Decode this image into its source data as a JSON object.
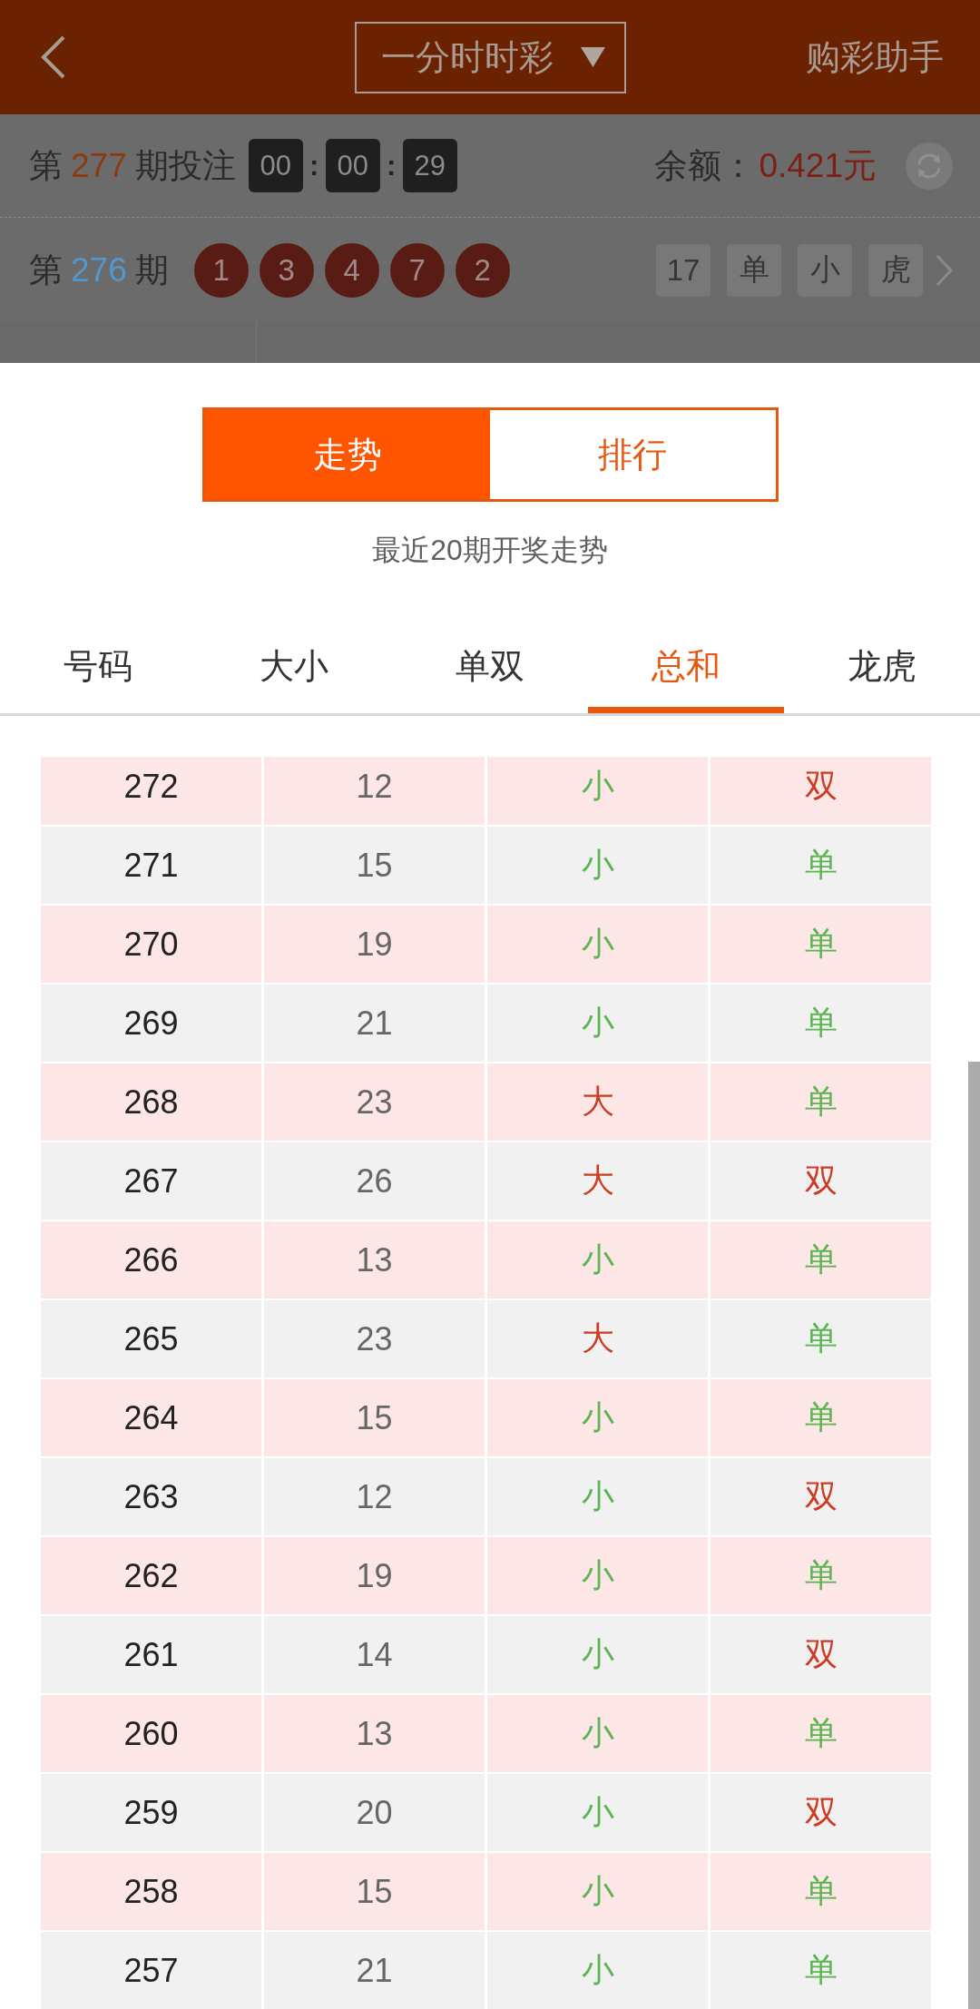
{
  "header": {
    "title": "一分时时彩",
    "assistant": "购彩助手"
  },
  "current_issue": {
    "prefix": "第",
    "number": "277",
    "suffix": "期投注",
    "countdown": [
      {
        "kind": "digits",
        "text": "00"
      },
      {
        "kind": "separator",
        "text": ":"
      },
      {
        "kind": "digits",
        "text": "00"
      },
      {
        "kind": "separator",
        "text": ":"
      },
      {
        "kind": "digits",
        "text": "29"
      }
    ],
    "balance_label": "余额：",
    "balance": "0.421元"
  },
  "last_draw": {
    "prefix": "第",
    "number": "276",
    "suffix": "期",
    "balls": [
      "1",
      "3",
      "4",
      "7",
      "2"
    ],
    "tags": [
      "17",
      "单",
      "小",
      "虎"
    ]
  },
  "view_switch": [
    {
      "label": "走势",
      "selected": true
    },
    {
      "label": "排行",
      "selected": false
    }
  ],
  "subtitle": "最近20期开奖走势",
  "tabs": [
    {
      "label": "号码",
      "selected": false
    },
    {
      "label": "大小",
      "selected": false
    },
    {
      "label": "单双",
      "selected": false
    },
    {
      "label": "总和",
      "selected": true
    },
    {
      "label": "龙虎",
      "selected": false
    }
  ],
  "table": {
    "rows": [
      {
        "column_1": "272",
        "column_2": "12",
        "column_3": {
          "text": "小",
          "color": "#5cb552"
        },
        "column_4": {
          "text": "双",
          "color": "#cc3b22"
        }
      },
      {
        "column_1": "271",
        "column_2": "15",
        "column_3": {
          "text": "小",
          "color": "#5cb552"
        },
        "column_4": {
          "text": "单",
          "color": "#5cb552"
        }
      },
      {
        "column_1": "270",
        "column_2": "19",
        "column_3": {
          "text": "小",
          "color": "#5cb552"
        },
        "column_4": {
          "text": "单",
          "color": "#5cb552"
        }
      },
      {
        "column_1": "269",
        "column_2": "21",
        "column_3": {
          "text": "小",
          "color": "#5cb552"
        },
        "column_4": {
          "text": "单",
          "color": "#5cb552"
        }
      },
      {
        "column_1": "268",
        "column_2": "23",
        "column_3": {
          "text": "大",
          "color": "#cc3b22"
        },
        "column_4": {
          "text": "单",
          "color": "#5cb552"
        }
      },
      {
        "column_1": "267",
        "column_2": "26",
        "column_3": {
          "text": "大",
          "color": "#cc3b22"
        },
        "column_4": {
          "text": "双",
          "color": "#cc3b22"
        }
      },
      {
        "column_1": "266",
        "column_2": "13",
        "column_3": {
          "text": "小",
          "color": "#5cb552"
        },
        "column_4": {
          "text": "单",
          "color": "#5cb552"
        }
      },
      {
        "column_1": "265",
        "column_2": "23",
        "column_3": {
          "text": "大",
          "color": "#cc3b22"
        },
        "column_4": {
          "text": "单",
          "color": "#5cb552"
        }
      },
      {
        "column_1": "264",
        "column_2": "15",
        "column_3": {
          "text": "小",
          "color": "#5cb552"
        },
        "column_4": {
          "text": "单",
          "color": "#5cb552"
        }
      },
      {
        "column_1": "263",
        "column_2": "12",
        "column_3": {
          "text": "小",
          "color": "#5cb552"
        },
        "column_4": {
          "text": "双",
          "color": "#cc3b22"
        }
      },
      {
        "column_1": "262",
        "column_2": "19",
        "column_3": {
          "text": "小",
          "color": "#5cb552"
        },
        "column_4": {
          "text": "单",
          "color": "#5cb552"
        }
      },
      {
        "column_1": "261",
        "column_2": "14",
        "column_3": {
          "text": "小",
          "color": "#5cb552"
        },
        "column_4": {
          "text": "双",
          "color": "#cc3b22"
        }
      },
      {
        "column_1": "260",
        "column_2": "13",
        "column_3": {
          "text": "小",
          "color": "#5cb552"
        },
        "column_4": {
          "text": "单",
          "color": "#5cb552"
        }
      },
      {
        "column_1": "259",
        "column_2": "20",
        "column_3": {
          "text": "小",
          "color": "#5cb552"
        },
        "column_4": {
          "text": "双",
          "color": "#cc3b22"
        }
      },
      {
        "column_1": "258",
        "column_2": "15",
        "column_3": {
          "text": "小",
          "color": "#5cb552"
        },
        "column_4": {
          "text": "单",
          "color": "#5cb552"
        }
      },
      {
        "column_1": "257",
        "column_2": "21",
        "column_3": {
          "text": "小",
          "color": "#5cb552"
        },
        "column_4": {
          "text": "单",
          "color": "#5cb552"
        }
      }
    ]
  }
}
